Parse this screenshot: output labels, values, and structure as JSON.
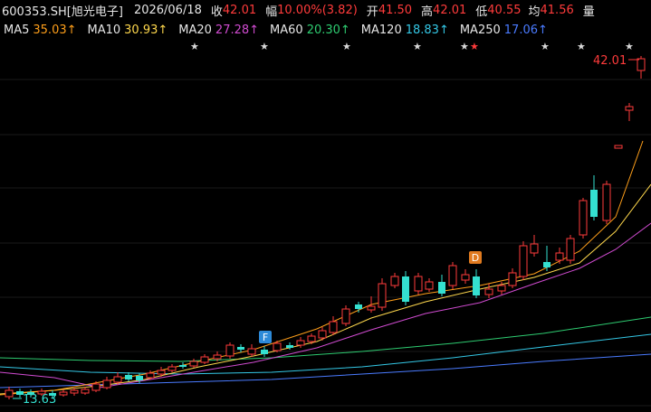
{
  "header": {
    "symbol": "600353.SH[旭光电子]",
    "date": "2026/06/18",
    "close_label": "收",
    "close_value": "42.01",
    "change_label": "幅",
    "change_value": "10.00%(3.82)",
    "open_label": "开",
    "open_value": "41.50",
    "high_label": "高",
    "high_value": "42.01",
    "low_label": "低",
    "low_value": "40.55",
    "avg_label": "均",
    "avg_value": "41.56",
    "volume_label": "量"
  },
  "ma": [
    {
      "label": "MA5",
      "value": "35.03↑",
      "color": "#ff9f1a"
    },
    {
      "label": "MA10",
      "value": "30.93↑",
      "color": "#ffd84d"
    },
    {
      "label": "MA20",
      "value": "27.28↑",
      "color": "#d04bd0"
    },
    {
      "label": "MA60",
      "value": "20.30↑",
      "color": "#2ecc71"
    },
    {
      "label": "MA120",
      "value": "18.83↑",
      "color": "#34c8e6"
    },
    {
      "label": "MA250",
      "value": "17.06↑",
      "color": "#4a7bff"
    }
  ],
  "annotations": {
    "high_price_label": "42.01",
    "low_price_label": "13.63",
    "marker_f": "F",
    "marker_d": "D"
  },
  "colors": {
    "up": "#ff3b3b",
    "down": "#34e0d0",
    "grid": "#1a1a1a",
    "star": "#d8d8d8"
  }
}
